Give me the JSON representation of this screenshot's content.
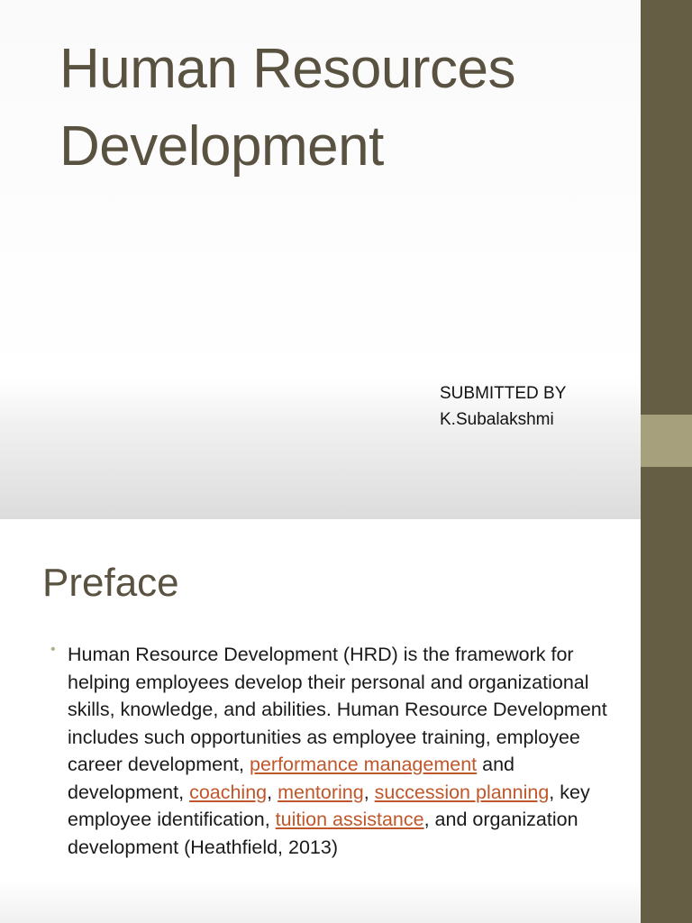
{
  "slide1": {
    "title_line1": "Human Resources",
    "title_line2": "Development",
    "submitted_label": "SUBMITTED BY",
    "author": "K.Subalakshmi"
  },
  "slide2": {
    "heading": "Preface",
    "bullet": {
      "text1": " Human Resource Development (HRD) is the framework for helping employees develop their personal and organizational skills, knowledge, and abilities. Human Resource Development includes such opportunities as employee training, employee career development, ",
      "link1": "performance management",
      "text2": " and development, ",
      "link2": "coaching",
      "text3": ", ",
      "link3": "mentoring",
      "text4": ", ",
      "link4": "succession planning",
      "text5": ", key employee identification, ",
      "link5": "tuition assistance",
      "text6": ", and organization development (Heathfield, 2013)"
    }
  },
  "colors": {
    "title": "#5a5240",
    "sidebar": "#665d45",
    "sidebar_accent": "#a6a07c",
    "link": "#c0572b"
  }
}
